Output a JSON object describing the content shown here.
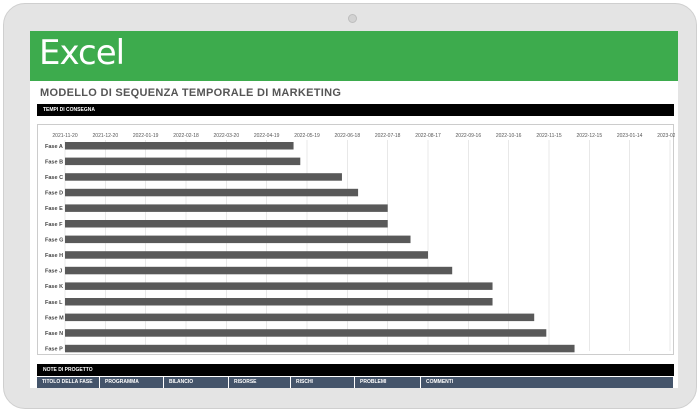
{
  "banner": {
    "title": "Excel"
  },
  "page_title": "MODELLO DI SEQUENZA TEMPORALE DI MARKETING",
  "timeline_section": "TEMPI DI CONSEGNA",
  "notes_section": "NOTE DI PROGETTO",
  "notes_columns": [
    "TITOLO DELLA FASE",
    "PROGRAMMA",
    "BILANCIO",
    "RISORSE",
    "RISCHI",
    "PROBLEMI",
    "COMMENTI"
  ],
  "colors": {
    "banner": "#3dab4d",
    "bar": "#595959",
    "notes_header": "#44546a",
    "section_bar": "#000000"
  },
  "chart_data": {
    "type": "bar",
    "orientation": "horizontal",
    "title": "",
    "xlabel": "",
    "ylabel": "",
    "grid": true,
    "legend": "none",
    "xlim": [
      "2021-11-20",
      "2023-02-13"
    ],
    "x_ticks": [
      "2021-11-20",
      "2021-12-20",
      "2022-01-19",
      "2022-02-18",
      "2022-03-20",
      "2022-04-19",
      "2022-05-19",
      "2022-06-18",
      "2022-07-18",
      "2022-08-17",
      "2022-09-16",
      "2022-10-16",
      "2022-11-15",
      "2022-12-15",
      "2023-01-14",
      "2023-02-13"
    ],
    "categories": [
      "Fase A",
      "Fase B",
      "Fase C",
      "Fase D",
      "Fase E",
      "Fase F",
      "Fase G",
      "Fase H",
      "Fase J",
      "Fase K",
      "Fase L",
      "Fase M",
      "Fase N",
      "Fase P"
    ],
    "values": [
      "2022-05-09",
      "2022-05-14",
      "2022-06-14",
      "2022-06-26",
      "2022-07-18",
      "2022-07-18",
      "2022-08-04",
      "2022-08-17",
      "2022-09-04",
      "2022-10-04",
      "2022-10-04",
      "2022-11-04",
      "2022-11-13",
      "2022-12-04"
    ]
  }
}
